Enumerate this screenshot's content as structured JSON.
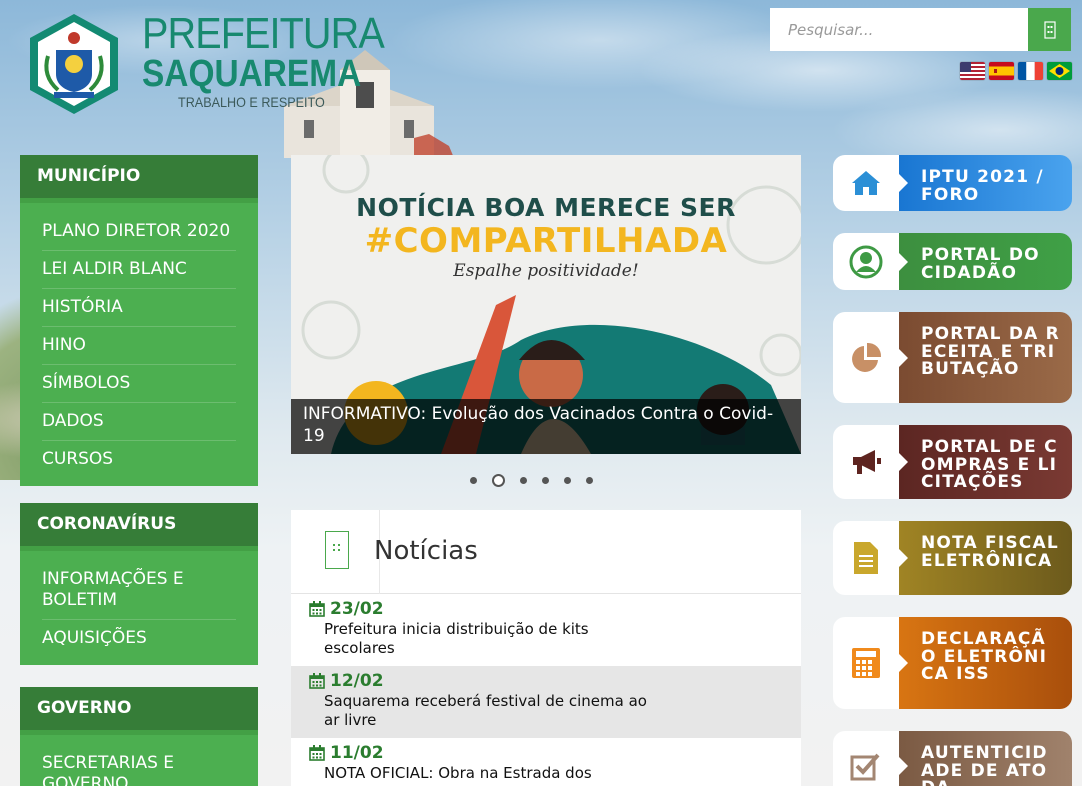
{
  "header": {
    "brand_line1": "PREFEITURA",
    "brand_line2": "SAQUAREMA",
    "brand_line3": "TRABALHO E RESPEITO",
    "search_placeholder": "Pesquisar...",
    "search_icon": "search-icon",
    "flags": [
      "english-flag",
      "spanish-flag",
      "french-flag",
      "portuguese-flag"
    ]
  },
  "sidebar": [
    {
      "title": "MUNICÍPIO",
      "items": [
        "PLANO DIRETOR 2020",
        "LEI ALDIR BLANC",
        "HISTÓRIA",
        "HINO",
        "SÍMBOLOS",
        "DADOS",
        "CURSOS"
      ]
    },
    {
      "title": "CORONAVÍRUS",
      "items": [
        "INFORMAÇÕES E BOLETIM",
        "AQUISIÇÕES"
      ]
    },
    {
      "title": "GOVERNO",
      "items": [
        "SECRETARIAS E GOVERNO"
      ]
    }
  ],
  "carousel": {
    "banner_line1": "NOTÍCIA BOA MERECE SER",
    "banner_line2": "#COMPARTILHADA",
    "banner_line3": "Espalhe positividade!",
    "caption": "INFORMATIVO: Evolução dos Vacinados Contra o Covid-19",
    "slide_count": 6,
    "active_slide": 2
  },
  "news": {
    "title": "Notícias",
    "items": [
      {
        "date": "23/02",
        "text": "Prefeitura inicia distribuição de kits escolares"
      },
      {
        "date": "12/02",
        "text": "Saquarema receberá festival de cinema ao ar livre"
      },
      {
        "date": "11/02",
        "text": "NOTA OFICIAL: Obra na Estrada dos"
      }
    ]
  },
  "services": [
    {
      "label": "IPTU 2021 / FORO",
      "icon": "home-icon",
      "color": "#1e88e5"
    },
    {
      "label": "PORTAL DO CIDADÃO",
      "icon": "user-circle-icon",
      "color": "#3e9a44"
    },
    {
      "label": "PORTAL DA RECEITA E TRIBUTAÇÃO",
      "icon": "pie-chart-icon",
      "color": "#8d5a3a"
    },
    {
      "label": "PORTAL DE COMPRAS E LICITAÇÕES",
      "icon": "megaphone-icon",
      "color": "#6e2f2a"
    },
    {
      "label": "NOTA FISCAL ELETRÔNICA",
      "icon": "document-icon",
      "color": "#a8902a"
    },
    {
      "label": "DECLARAÇÃO ELETRÔNICA ISS",
      "icon": "calculator-icon",
      "color": "#d57a14"
    },
    {
      "label": "AUTENTICIDADE DE ATO DA",
      "icon": "checkbox-icon",
      "color": "#8d6e57"
    }
  ]
}
